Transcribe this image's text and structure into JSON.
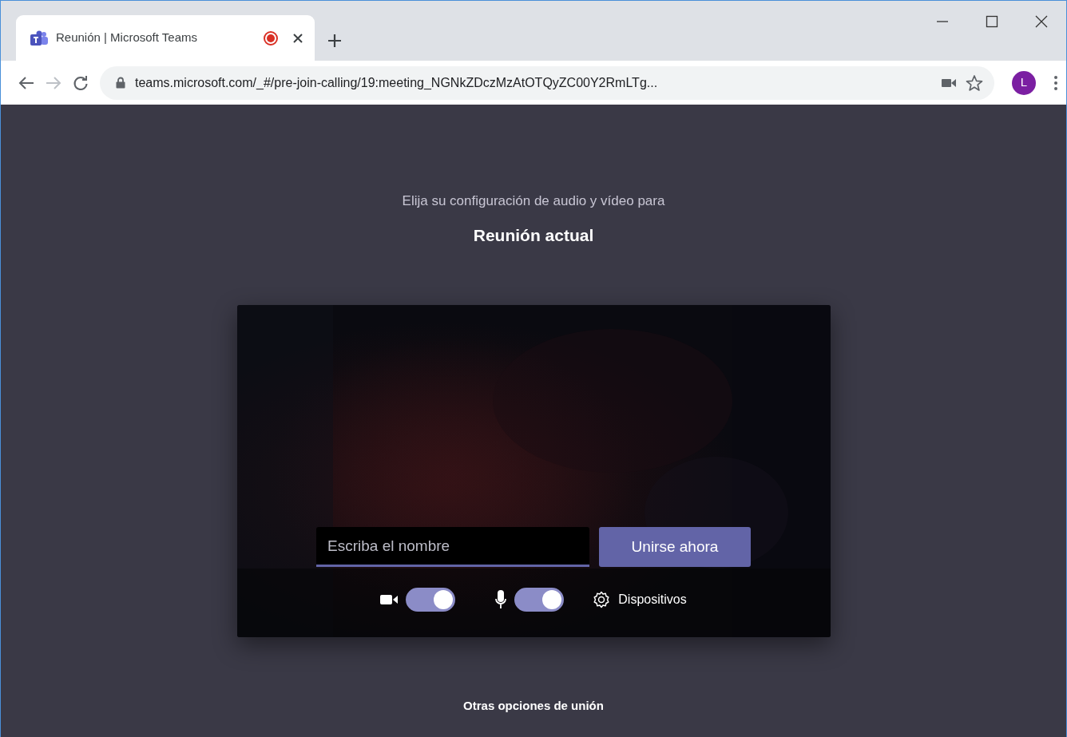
{
  "browser": {
    "tab": {
      "title": "Reunión | Microsoft Teams",
      "recording": true
    },
    "address": "teams.microsoft.com/_#/pre-join-calling/19:meeting_NGNkZDczMzAtOTQyZC00Y2RmLTg...",
    "profile_initial": "L"
  },
  "prejoin": {
    "intro": "Elija su configuración de audio y vídeo para",
    "meeting_title": "Reunión actual",
    "name_field": {
      "placeholder": "Escriba el nombre"
    },
    "join_button": "Unirse ahora",
    "camera": {
      "on": true
    },
    "microphone": {
      "on": true
    },
    "devices_button": "Dispositivos"
  },
  "other_options": "Otras opciones de unión"
}
